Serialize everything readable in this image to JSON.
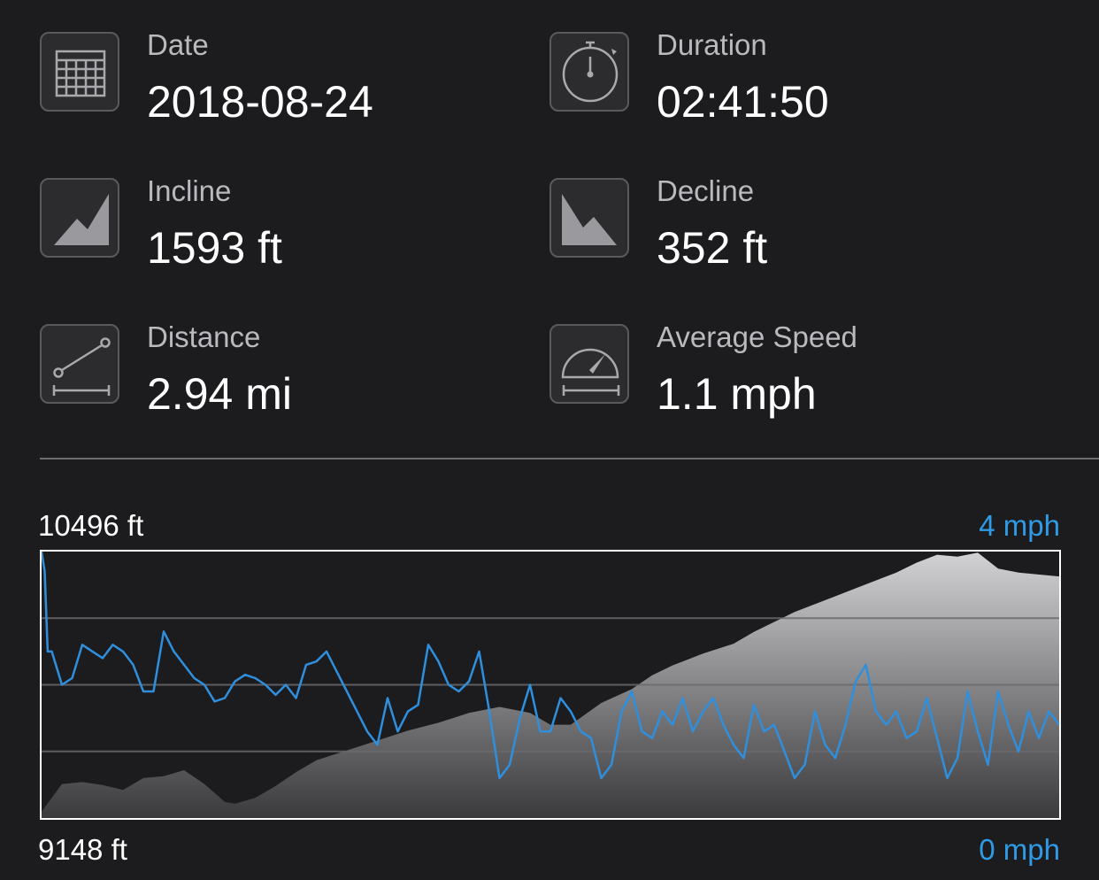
{
  "stats": {
    "date": {
      "label": "Date",
      "value": "2018-08-24",
      "icon": "calendar-icon"
    },
    "duration": {
      "label": "Duration",
      "value": "02:41:50",
      "icon": "stopwatch-icon"
    },
    "incline": {
      "label": "Incline",
      "value": "1593 ft",
      "icon": "incline-icon"
    },
    "decline": {
      "label": "Decline",
      "value": "352 ft",
      "icon": "decline-icon"
    },
    "distance": {
      "label": "Distance",
      "value": "2.94 mi",
      "icon": "distance-icon"
    },
    "avg_speed": {
      "label": "Average Speed",
      "value": "1.1 mph",
      "icon": "speedometer-icon"
    }
  },
  "chart": {
    "elev_max_label": "10496 ft",
    "elev_min_label": "9148 ft",
    "speed_max_label": "4 mph",
    "speed_min_label": "0 mph"
  },
  "colors": {
    "background": "#1c1c1e",
    "speed_line": "#2f8fdd",
    "speed_label": "#2f9be6",
    "elevation_fill_top": "#d2d2d4",
    "elevation_fill_bottom": "#3a3a3c"
  },
  "chart_data": {
    "type": "area",
    "x_is_fraction_of_activity": true,
    "elevation": {
      "unit": "ft",
      "ylim": [
        9148,
        10496
      ],
      "x": [
        0.0,
        0.02,
        0.04,
        0.06,
        0.08,
        0.1,
        0.12,
        0.14,
        0.16,
        0.18,
        0.19,
        0.21,
        0.23,
        0.25,
        0.27,
        0.3,
        0.33,
        0.36,
        0.39,
        0.42,
        0.45,
        0.48,
        0.5,
        0.52,
        0.55,
        0.58,
        0.6,
        0.62,
        0.65,
        0.68,
        0.7,
        0.72,
        0.74,
        0.76,
        0.78,
        0.8,
        0.82,
        0.84,
        0.86,
        0.88,
        0.9,
        0.92,
        0.94,
        0.96,
        1.0
      ],
      "values": [
        9180,
        9320,
        9330,
        9315,
        9290,
        9350,
        9360,
        9390,
        9320,
        9230,
        9220,
        9250,
        9310,
        9380,
        9440,
        9490,
        9540,
        9590,
        9630,
        9680,
        9710,
        9680,
        9620,
        9620,
        9730,
        9800,
        9870,
        9920,
        9980,
        10030,
        10090,
        10140,
        10190,
        10230,
        10270,
        10310,
        10350,
        10390,
        10440,
        10480,
        10470,
        10490,
        10410,
        10390,
        10370
      ]
    },
    "speed": {
      "unit": "mph",
      "ylim": [
        0,
        4
      ],
      "x": [
        0.0,
        0.003,
        0.006,
        0.01,
        0.02,
        0.03,
        0.04,
        0.05,
        0.06,
        0.07,
        0.08,
        0.09,
        0.1,
        0.11,
        0.12,
        0.13,
        0.14,
        0.15,
        0.16,
        0.17,
        0.18,
        0.19,
        0.2,
        0.21,
        0.22,
        0.23,
        0.24,
        0.25,
        0.26,
        0.27,
        0.28,
        0.29,
        0.3,
        0.31,
        0.32,
        0.33,
        0.34,
        0.35,
        0.36,
        0.37,
        0.38,
        0.39,
        0.4,
        0.41,
        0.42,
        0.43,
        0.44,
        0.45,
        0.46,
        0.47,
        0.48,
        0.49,
        0.5,
        0.51,
        0.52,
        0.53,
        0.54,
        0.55,
        0.56,
        0.57,
        0.58,
        0.59,
        0.6,
        0.61,
        0.62,
        0.63,
        0.64,
        0.65,
        0.66,
        0.67,
        0.68,
        0.69,
        0.7,
        0.71,
        0.72,
        0.73,
        0.74,
        0.75,
        0.76,
        0.77,
        0.78,
        0.79,
        0.8,
        0.81,
        0.82,
        0.83,
        0.84,
        0.85,
        0.86,
        0.87,
        0.88,
        0.89,
        0.9,
        0.91,
        0.92,
        0.93,
        0.94,
        0.95,
        0.96,
        0.97,
        0.98,
        0.99,
        1.0
      ],
      "values": [
        4.0,
        3.7,
        2.5,
        2.5,
        2.0,
        2.1,
        2.6,
        2.5,
        2.4,
        2.6,
        2.5,
        2.3,
        1.9,
        1.9,
        2.8,
        2.5,
        2.3,
        2.1,
        2.0,
        1.75,
        1.8,
        2.05,
        2.15,
        2.1,
        2.0,
        1.85,
        2.0,
        1.8,
        2.3,
        2.35,
        2.5,
        2.2,
        1.9,
        1.6,
        1.3,
        1.1,
        1.8,
        1.3,
        1.6,
        1.7,
        2.6,
        2.35,
        2.0,
        1.9,
        2.05,
        2.5,
        1.6,
        0.6,
        0.8,
        1.5,
        2.0,
        1.3,
        1.3,
        1.8,
        1.6,
        1.3,
        1.2,
        0.6,
        0.8,
        1.6,
        1.9,
        1.3,
        1.2,
        1.6,
        1.4,
        1.8,
        1.3,
        1.6,
        1.8,
        1.4,
        1.1,
        0.9,
        1.7,
        1.3,
        1.4,
        1.0,
        0.6,
        0.8,
        1.6,
        1.1,
        0.9,
        1.4,
        2.05,
        2.3,
        1.6,
        1.4,
        1.6,
        1.2,
        1.3,
        1.8,
        1.2,
        0.6,
        0.9,
        1.9,
        1.3,
        0.8,
        1.9,
        1.4,
        1.0,
        1.6,
        1.2,
        1.6,
        1.4
      ]
    },
    "gridlines_y_fraction": [
      0.75,
      0.5,
      0.25
    ],
    "grid": true
  }
}
